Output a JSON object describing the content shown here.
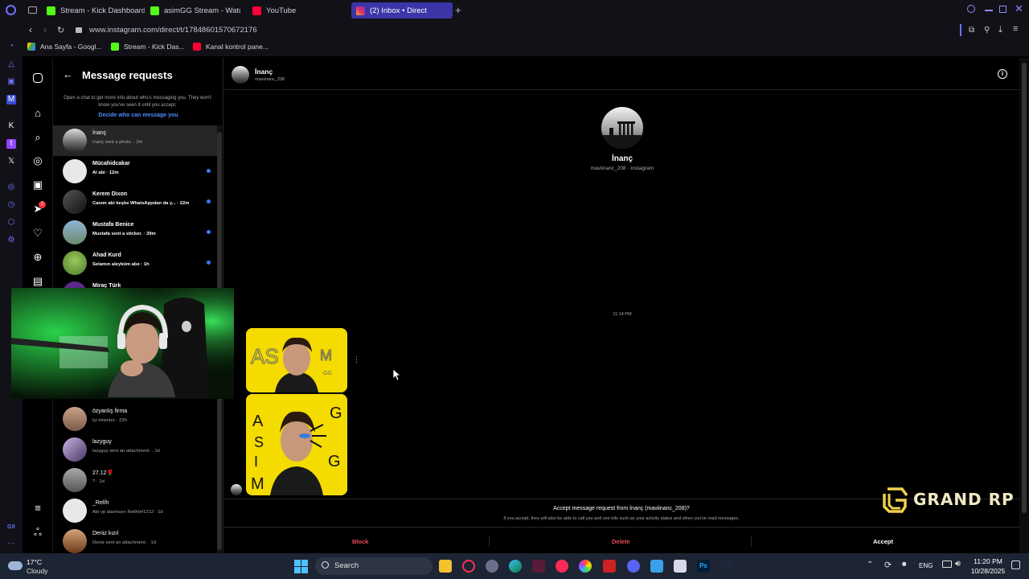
{
  "browser": {
    "tabs": [
      {
        "label": "Stream - Kick Dashboard",
        "icon": "kick-icon",
        "color": "#53fc18"
      },
      {
        "label": "asimGG Stream - Watch L",
        "icon": "kick-icon",
        "color": "#53fc18"
      },
      {
        "label": "YouTube",
        "icon": "youtube-icon",
        "color": "#ff0033"
      },
      {
        "label": "(2) Inbox • Direct",
        "icon": "instagram-icon",
        "color": "#e1306c"
      }
    ],
    "url": "www.instagram.com/direct/t/17848601570672176",
    "bookmarks": [
      {
        "label": "Ana Sayfa - Googl...",
        "icon": "google-drive-icon"
      },
      {
        "label": "Stream - Kick Das...",
        "icon": "kick-icon"
      },
      {
        "label": "Kanal kontrol pane...",
        "icon": "youtube-icon"
      }
    ]
  },
  "requests": {
    "title": "Message requests",
    "info": "Open a chat to get more info about who's messaging you. They won't know you've seen it until you accept.",
    "decide": "Decide who can message you",
    "rows": [
      {
        "name": "İnanç",
        "sub": "İnanç sent a photo. · 2m"
      },
      {
        "name": "Mücahidcakar",
        "sub": "Al abi · 12m"
      },
      {
        "name": "Kerem Dixon",
        "sub": "Canım abi keşke WhatsAppdan da y... · 22m"
      },
      {
        "name": "Mustafa Benice",
        "sub": "Mustafa sent a sticker. · 39m"
      },
      {
        "name": "Ahad Kurd",
        "sub": "Selamın aleyküm abə · 1h"
      },
      {
        "name": "Miraç Türk",
        "sub": ""
      },
      {
        "name": "özyanlış firma",
        "sub": "İyi misinizz · 22h"
      },
      {
        "name": "lazyguy",
        "sub": "lazyguy sent an attachment. · 1d"
      },
      {
        "name": "27.12🌹",
        "sub": "? · 1d"
      },
      {
        "name": "_Relİh",
        "sub": "Abi vp atarmısın Reilhh#1212 · 1d"
      },
      {
        "name": "Deniz kızıl",
        "sub": "Deniz sent an attachment. · 1d"
      }
    ]
  },
  "chat": {
    "name": "İnanç",
    "username": "maviinanc_208",
    "profile_name": "İnanç",
    "profile_sub": "maviinanc_208 · Instagram",
    "time": "11:14 PM",
    "accept_title": "Accept message request from İnanç (maviinanc_208)?",
    "accept_sub": "If you accept, they will also be able to call you and see info such as your activity status and when you've read messages.",
    "block": "Block",
    "delete": "Delete",
    "accept": "Accept",
    "block_color": "#ed4956"
  },
  "watermark": {
    "text": "GRAND RP"
  },
  "taskbar": {
    "temp": "17°C",
    "weather": "Cloudy",
    "search": "Search",
    "lang": "ENG",
    "time": "11:20 PM",
    "date": "10/28/2025"
  },
  "badges": {
    "notifications": "2"
  }
}
